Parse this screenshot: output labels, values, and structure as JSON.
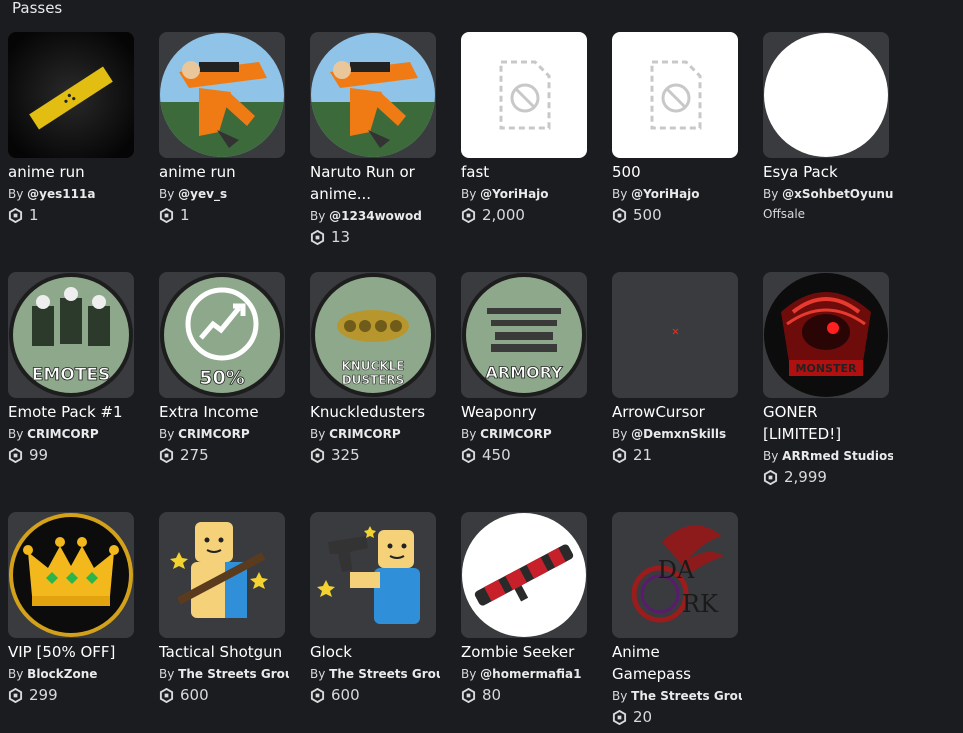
{
  "section": {
    "title": "Passes"
  },
  "passes": [
    {
      "name": "anime run",
      "by": "By",
      "creator": "@yes111a",
      "price": "1"
    },
    {
      "name": "anime run",
      "by": "By",
      "creator": "@yev_s",
      "price": "1"
    },
    {
      "name": "Naruto Run or anime...",
      "by": "By",
      "creator": "@1234wowod",
      "price": "13"
    },
    {
      "name": "fast",
      "by": "By",
      "creator": "@YoriHajo",
      "price": "2,000"
    },
    {
      "name": "500",
      "by": "By",
      "creator": "@YoriHajo",
      "price": "500"
    },
    {
      "name": "Esya Pack",
      "by": "By",
      "creator": "@xSohbetOyunu...",
      "status": "Offsale"
    },
    {
      "name": "Emote Pack #1",
      "by": "By",
      "creator": "CRIMCORP",
      "price": "99",
      "thumb_text": "EMOTES"
    },
    {
      "name": "Extra Income",
      "by": "By",
      "creator": "CRIMCORP",
      "price": "275",
      "thumb_text": "50%"
    },
    {
      "name": "Knuckledusters",
      "by": "By",
      "creator": "CRIMCORP",
      "price": "325",
      "thumb_text_1": "KNUCKLE",
      "thumb_text_2": "DUSTERS"
    },
    {
      "name": "Weaponry",
      "by": "By",
      "creator": "CRIMCORP",
      "price": "450",
      "thumb_text": "ARMORY"
    },
    {
      "name": "ArrowCursor",
      "by": "By",
      "creator": "@DemxnSkills",
      "price": "21"
    },
    {
      "name": "GONER [LIMITED!]",
      "by": "By",
      "creator": "ARRmed Studios",
      "price": "2,999",
      "thumb_text": "MONSTER"
    },
    {
      "name": "VIP [50% OFF]",
      "by": "By",
      "creator": "BlockZone",
      "price": "299"
    },
    {
      "name": "Tactical Shotgun",
      "by": "By",
      "creator": "The Streets Group",
      "price": "600"
    },
    {
      "name": "Glock",
      "by": "By",
      "creator": "The Streets Group",
      "price": "600"
    },
    {
      "name": "Zombie Seeker",
      "by": "By",
      "creator": "@homermafia1",
      "price": "80"
    },
    {
      "name": "Anime Gamepass",
      "by": "By",
      "creator": "The Streets Group",
      "price": "20",
      "thumb_text_1": "DA",
      "thumb_text_2": "RK"
    }
  ],
  "colors": {
    "background": "#1b1c1f",
    "tile": "#393b3f",
    "text": "#ffffff",
    "muted": "#d8d9da"
  },
  "icons": {
    "price": "robux-icon",
    "placeholder": "broken-image-icon"
  }
}
